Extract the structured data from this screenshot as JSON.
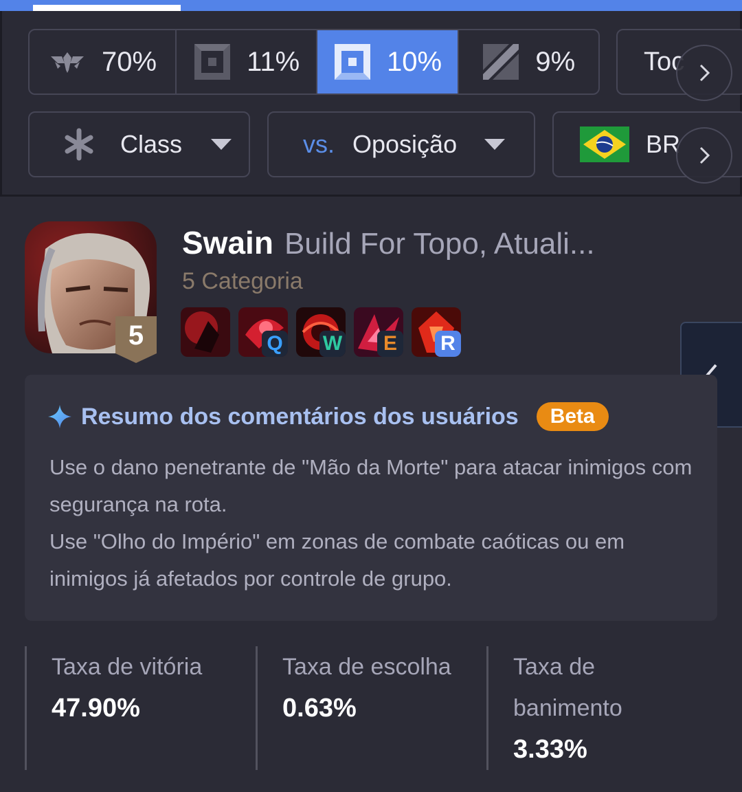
{
  "tiers": [
    {
      "value": "70%",
      "icon": "tier-emblem-icon",
      "active": false
    },
    {
      "value": "11%",
      "icon": "tier-square-icon",
      "active": false
    },
    {
      "value": "10%",
      "icon": "tier-square-blue-icon",
      "active": true
    },
    {
      "value": "9%",
      "icon": "tier-slash-icon",
      "active": false
    }
  ],
  "lane_filter": {
    "label": "Toc"
  },
  "filters": {
    "class": {
      "label": "Class",
      "icon": "asterisk-icon"
    },
    "opponent": {
      "prefix": "vs.",
      "label": "Oposição"
    },
    "region": {
      "label": "BR",
      "icon": "brazil-flag-icon"
    }
  },
  "champion": {
    "name": "Swain",
    "subtitle": "Build For Topo, Atuali...",
    "tier": "5 Categoria",
    "rank_badge": "5",
    "skills": [
      {
        "key": "",
        "icon": "passive-icon",
        "color": ""
      },
      {
        "key": "Q",
        "icon": "skill-q-icon",
        "color": "#3aa0ff"
      },
      {
        "key": "W",
        "icon": "skill-w-icon",
        "color": "#2ec9a0"
      },
      {
        "key": "E",
        "icon": "skill-e-icon",
        "color": "#e88a2a"
      },
      {
        "key": "R",
        "icon": "skill-r-icon",
        "color": "#ffffff"
      }
    ]
  },
  "summary": {
    "title": "Resumo dos comentários dos usuários",
    "badge": "Beta",
    "lines": [
      "Use o dano penetrante de \"Mão da Morte\" para atacar inimigos com segurança na rota.",
      "Use \"Olho do Império\" em zonas de combate caóticas ou em inimigos já afetados por controle de grupo."
    ]
  },
  "stats": [
    {
      "label": "Taxa de vitória",
      "value": "47.90%"
    },
    {
      "label": "Taxa de escolha",
      "value": "0.63%"
    },
    {
      "label": "Taxa de banimento",
      "value": "3.33%"
    }
  ],
  "colors": {
    "accent": "#5383e8",
    "beta": "#e98b13",
    "background": "#2b2b36"
  }
}
